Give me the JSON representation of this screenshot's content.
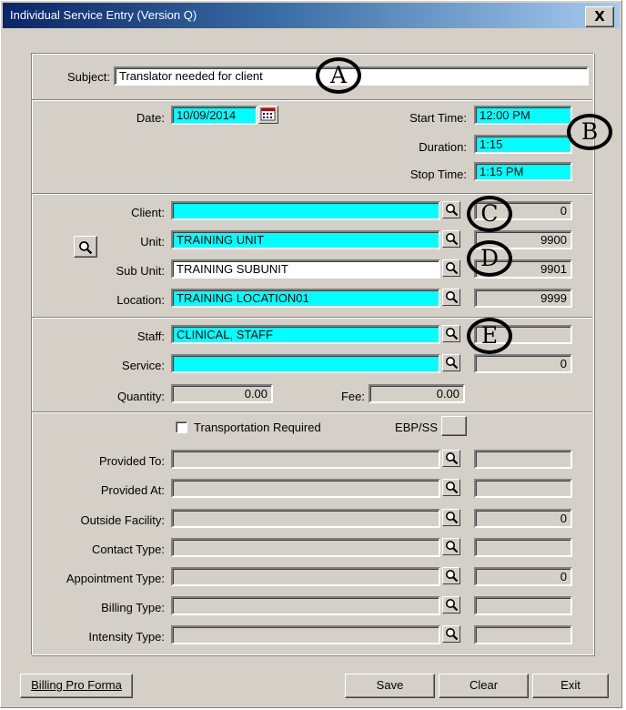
{
  "window": {
    "title": "Individual Service Entry (Version Q)",
    "close_label": "X"
  },
  "subject": {
    "label": "Subject:",
    "value": "Translator needed for client"
  },
  "datetime": {
    "date_label": "Date:",
    "date_value": "10/09/2014",
    "start_label": "Start Time:",
    "start_value": "12:00 PM",
    "duration_label": "Duration:",
    "duration_value": "1:15",
    "stop_label": "Stop Time:",
    "stop_value": "1:15 PM"
  },
  "client_section": {
    "client_label": "Client:",
    "client_value": "",
    "client_code": "0",
    "unit_label": "Unit:",
    "unit_value": "TRAINING UNIT",
    "unit_code": "9900",
    "subunit_label": "Sub Unit:",
    "subunit_value": "TRAINING SUBUNIT",
    "subunit_code": "9901",
    "location_label": "Location:",
    "location_value": "TRAINING LOCATION01",
    "location_code": "9999"
  },
  "staff_section": {
    "staff_label": "Staff:",
    "staff_value": "CLINICAL, STAFF",
    "staff_code": "",
    "service_label": "Service:",
    "service_value": "",
    "service_code": "0",
    "quantity_label": "Quantity:",
    "quantity_value": "0.00",
    "fee_label": "Fee:",
    "fee_value": "0.00"
  },
  "other_section": {
    "transport_label": "Transportation Required",
    "transport_checked": false,
    "ebp_label": "EBP/SS",
    "rows": [
      {
        "label": "Provided To:",
        "value": "",
        "code": ""
      },
      {
        "label": "Provided At:",
        "value": "",
        "code": ""
      },
      {
        "label": "Outside Facility:",
        "value": "",
        "code": "0"
      },
      {
        "label": "Contact Type:",
        "value": "",
        "code": ""
      },
      {
        "label": "Appointment Type:",
        "value": "",
        "code": "0"
      },
      {
        "label": "Billing Type:",
        "value": "",
        "code": ""
      },
      {
        "label": "Intensity Type:",
        "value": "",
        "code": ""
      }
    ]
  },
  "callouts": {
    "a": "A",
    "b": "B",
    "c": "C",
    "d": "D",
    "e": "E"
  },
  "buttons": {
    "billing_pro_forma": "Billing Pro Forma",
    "save": "Save",
    "clear": "Clear",
    "exit": "Exit"
  },
  "icons": {
    "lookup": "magnifier-icon",
    "calendar": "calendar-icon"
  },
  "colors": {
    "required_field": "#00ffff",
    "title_start": "#0a246a",
    "title_end": "#a6caf0"
  }
}
